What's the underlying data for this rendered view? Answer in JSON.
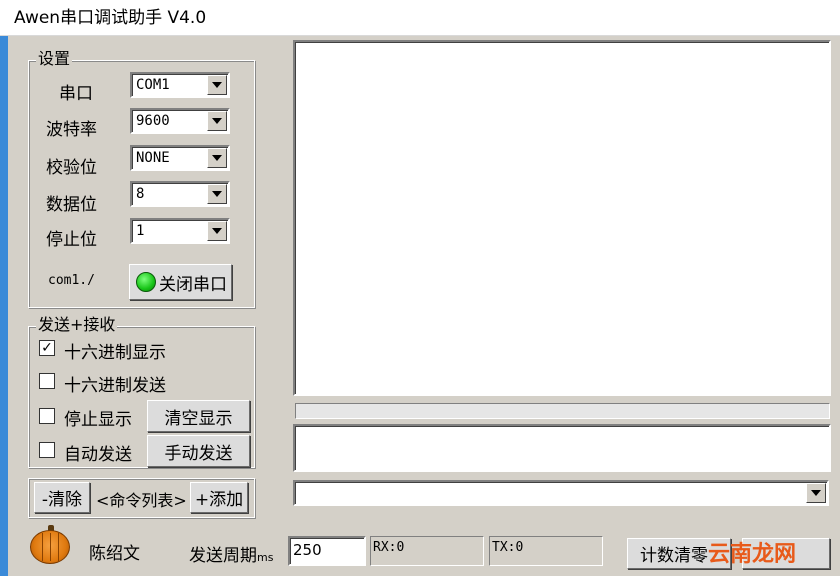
{
  "window": {
    "title": "Awen串口调试助手 V4.0"
  },
  "settings": {
    "group_title": "设置",
    "port": {
      "label": "串口",
      "value": "COM1"
    },
    "baud": {
      "label": "波特率",
      "value": "9600"
    },
    "parity": {
      "label": "校验位",
      "value": "NONE"
    },
    "databits": {
      "label": "数据位",
      "value": "8"
    },
    "stopbits": {
      "label": "停止位",
      "value": "1"
    },
    "status_text": "com1./",
    "toggle_button": "关闭串口"
  },
  "sendrecv": {
    "group_title": "发送+接收",
    "hex_display": {
      "label": "十六进制显示",
      "checked": true,
      "mark": "✓"
    },
    "hex_send": {
      "label": "十六进制发送",
      "checked": false
    },
    "stop_display": {
      "label": "停止显示",
      "checked": false
    },
    "auto_send": {
      "label": "自动发送",
      "checked": false
    },
    "clear_display_button": "清空显示",
    "manual_send_button": "手动发送"
  },
  "commands": {
    "clear_button": "-清除",
    "list_label": "<命令列表>",
    "add_button": "+添加"
  },
  "footer": {
    "author": "陈绍文",
    "period_label": "发送周期",
    "period_unit": "ms",
    "period_value": "250",
    "rx_label": "RX:0",
    "tx_label": "TX:0",
    "reset_count_button": "计数清零",
    "watermark": "云南龙网"
  },
  "colors": {
    "window_frame": "#3a8ad8",
    "led_on": "#17c417",
    "watermark": "#e85a1a"
  }
}
